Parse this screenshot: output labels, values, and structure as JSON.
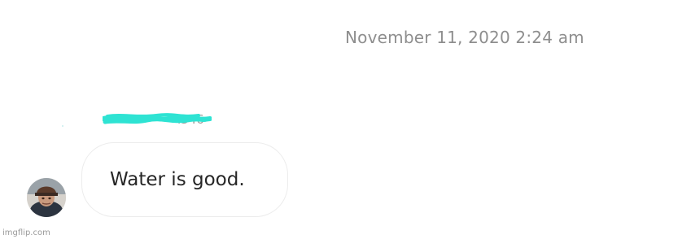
{
  "conversation": {
    "timestamp": "November 11, 2020 2:24 am",
    "sender": {
      "name_partial": "i346",
      "redaction_color": "#2ee3d3"
    },
    "message": {
      "text": "Water is good."
    },
    "avatar_icon": "user-avatar-photo"
  },
  "watermark": {
    "text": "imgflip.com"
  },
  "colors": {
    "timestamp": "#8e8e8e",
    "message_text": "#262626",
    "bubble_border": "#ececec"
  }
}
